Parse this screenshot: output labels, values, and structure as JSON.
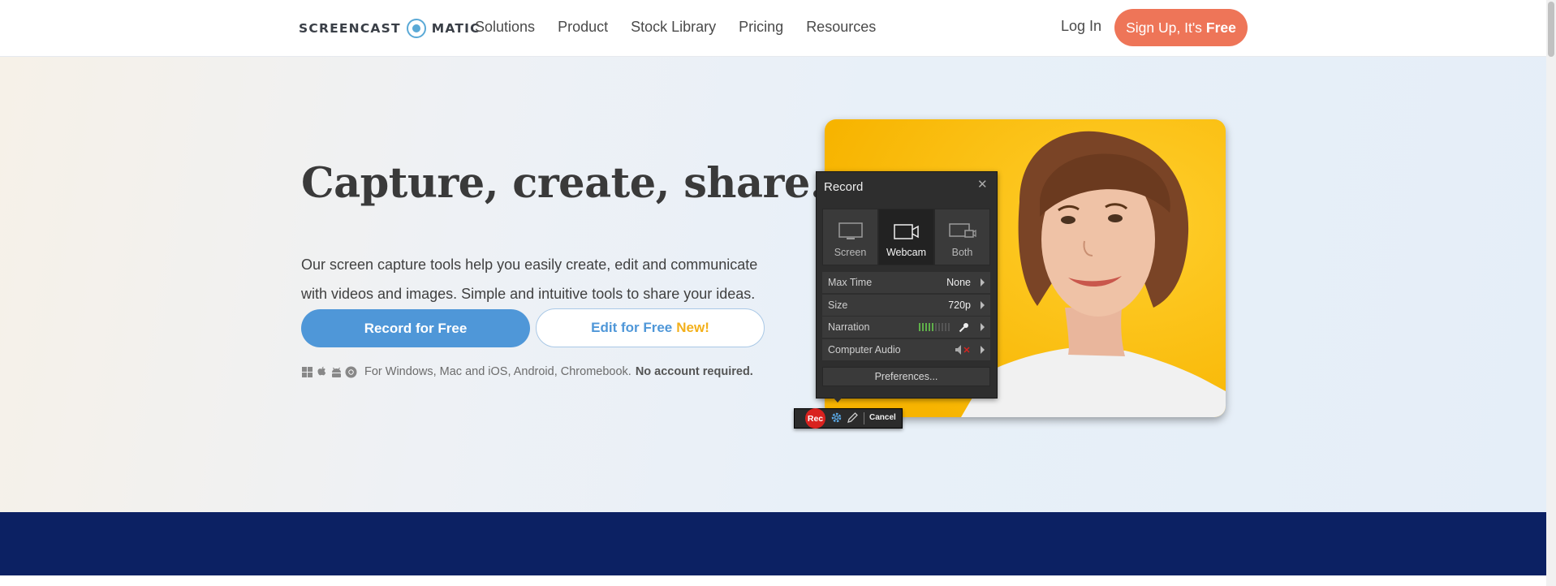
{
  "header": {
    "logo_left": "SCREENCAST",
    "logo_right": "MATIC",
    "nav": [
      "Solutions",
      "Product",
      "Stock Library",
      "Pricing",
      "Resources"
    ],
    "login": "Log In",
    "signup_prefix": "Sign Up, It's",
    "signup_bold": "Free"
  },
  "hero": {
    "title": "Capture, create, share.",
    "description": "Our screen capture tools help you easily create, edit and communicate with videos and images. Simple and intuitive tools to share your ideas.",
    "record_button": "Record for Free",
    "edit_button": "Edit for Free",
    "edit_badge": "New!",
    "platforms_text": "For Windows, Mac and iOS, Android, Chromebook.",
    "platforms_bold": "No account required.",
    "platform_icons": [
      "windows-icon",
      "apple-icon",
      "android-icon",
      "chrome-icon"
    ]
  },
  "recorder": {
    "title": "Record",
    "modes": [
      "Screen",
      "Webcam",
      "Both"
    ],
    "active_mode": "Webcam",
    "rows": [
      {
        "label": "Max Time",
        "value": "None"
      },
      {
        "label": "Size",
        "value": "720p"
      },
      {
        "label": "Narration",
        "value": ""
      },
      {
        "label": "Computer Audio",
        "value": ""
      }
    ],
    "narration_level": 0.5,
    "preferences": "Preferences...",
    "rec": "Rec",
    "cancel": "Cancel"
  },
  "colors": {
    "accent_orange": "#ee7558",
    "primary_blue": "#4f97d8",
    "new_badge": "#f3b01b",
    "band_navy": "#0c2163",
    "rec_red": "#d9221f"
  }
}
